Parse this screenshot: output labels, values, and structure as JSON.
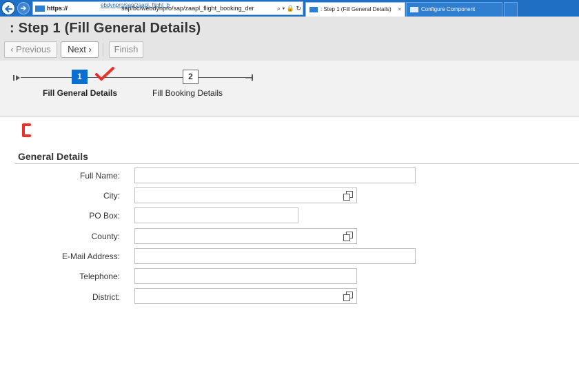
{
  "browser": {
    "url_prefix": "https://",
    "url_ghost": "ebdynpro/sap/zaapl_flight_b",
    "url_rest": "sap/bc/webdynpro/sap/zaapl_flight_booking_der",
    "url_tools": "⌕ ▾ 🔒 ↻",
    "tabs": [
      {
        "label": ": Step 1  (Fill General Details)",
        "close": "×"
      },
      {
        "label": "Configure Component"
      }
    ]
  },
  "header": {
    "title": ": Step 1  (Fill General Details)",
    "prev_label": "‹ Previous",
    "next_label": "Next ›",
    "finish_label": "Finish"
  },
  "roadmap": {
    "steps": [
      {
        "number": "1",
        "label": "Fill General Details",
        "status": "current"
      },
      {
        "number": "2",
        "label": "Fill Booking Details",
        "status": "pending"
      }
    ]
  },
  "form": {
    "section_title": "General Details",
    "fields": [
      {
        "label": "Full Name:",
        "value": ""
      },
      {
        "label": "City:",
        "value": ""
      },
      {
        "label": "PO Box:",
        "value": ""
      },
      {
        "label": "County:",
        "value": ""
      },
      {
        "label": "E-Mail Address:",
        "value": ""
      },
      {
        "label": "Telephone:",
        "value": ""
      },
      {
        "label": "District:",
        "value": ""
      }
    ]
  },
  "colors": {
    "browser_bar": "#1f6fc5",
    "header_bg": "#e5e5e5",
    "roadmap_bg": "#f2f2f2",
    "step_active": "#0a6ed1",
    "annotation_red": "#e8312a"
  },
  "icons": [
    "back-arrow-icon",
    "forward-arrow-icon",
    "value-help-icon",
    "roadmap-start-icon",
    "roadmap-end-icon"
  ]
}
